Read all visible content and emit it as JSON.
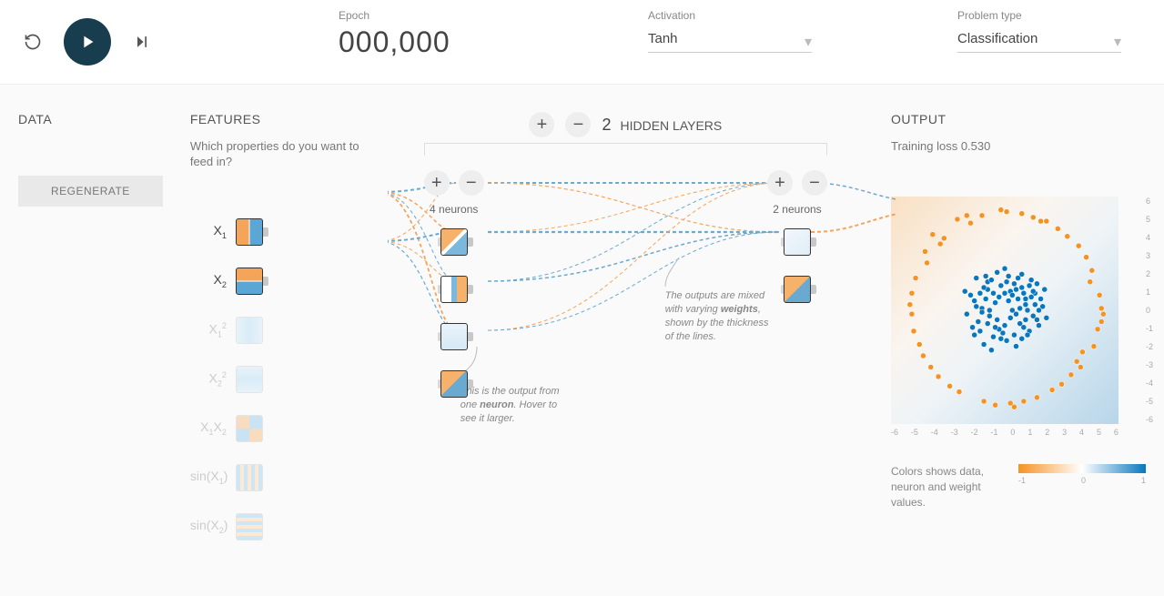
{
  "topbar": {
    "epoch_label": "Epoch",
    "epoch_value": "000,000",
    "activation_label": "Activation",
    "activation_value": "Tanh",
    "problem_label": "Problem type",
    "problem_value": "Classification"
  },
  "data": {
    "title": "DATA",
    "regenerate": "REGENERATE"
  },
  "features": {
    "title": "FEATURES",
    "subtitle": "Which properties do you want to feed in?",
    "items": [
      {
        "label": "X",
        "sub": "1",
        "active": true
      },
      {
        "label": "X",
        "sub": "2",
        "active": true
      },
      {
        "label": "X",
        "sub": "1",
        "sup": "2",
        "active": false
      },
      {
        "label": "X",
        "sub": "2",
        "sup": "2",
        "active": false
      },
      {
        "label": "X",
        "sub": "1",
        "label2": "X",
        "sub2": "2",
        "active": false
      },
      {
        "label": "sin(X",
        "sub": "1",
        "tail": ")",
        "active": false
      },
      {
        "label": "sin(X",
        "sub": "2",
        "tail": ")",
        "active": false
      }
    ]
  },
  "network": {
    "count": "2",
    "title": "HIDDEN LAYERS",
    "layers": [
      {
        "caption": "4 neurons",
        "neurons": 4
      },
      {
        "caption": "2 neurons",
        "neurons": 2
      }
    ],
    "callout_weights": "The outputs are mixed with varying weights, shown by the thickness of the lines.",
    "callout_weights_bold": "weights",
    "callout_neuron": "This is the output from one neuron. Hover to see it larger.",
    "callout_neuron_bold": "neuron"
  },
  "output": {
    "title": "OUTPUT",
    "loss_label": "Training loss",
    "loss_value": "0.530",
    "ticks": [
      "-6",
      "-5",
      "-4",
      "-3",
      "-2",
      "-1",
      "0",
      "1",
      "2",
      "3",
      "4",
      "5",
      "6"
    ],
    "legend_text": "Colors shows data, neuron and weight values.",
    "legend_ticks": [
      "-1",
      "0",
      "1"
    ]
  },
  "chart_data": {
    "type": "scatter",
    "title": "",
    "xlabel": "",
    "ylabel": "",
    "xlim": [
      -6,
      6
    ],
    "ylim": [
      -6,
      6
    ],
    "series": [
      {
        "name": "class-orange",
        "color": "#f59322",
        "points": [
          [
            -4.2,
            3.1
          ],
          [
            -3.8,
            4.0
          ],
          [
            -2.5,
            4.8
          ],
          [
            -1.2,
            5.0
          ],
          [
            0.1,
            5.2
          ],
          [
            1.5,
            4.9
          ],
          [
            2.8,
            4.3
          ],
          [
            3.9,
            3.4
          ],
          [
            4.6,
            2.1
          ],
          [
            5.0,
            0.8
          ],
          [
            5.1,
            -0.6
          ],
          [
            4.7,
            -1.9
          ],
          [
            4.0,
            -3.0
          ],
          [
            3.0,
            -3.9
          ],
          [
            1.7,
            -4.6
          ],
          [
            0.3,
            -4.9
          ],
          [
            -1.1,
            -4.8
          ],
          [
            -2.4,
            -4.3
          ],
          [
            -3.5,
            -3.5
          ],
          [
            -4.3,
            -2.4
          ],
          [
            -4.8,
            -1.1
          ],
          [
            -5.0,
            0.3
          ],
          [
            -4.7,
            1.7
          ],
          [
            -2.0,
            5.0
          ],
          [
            2.2,
            4.7
          ],
          [
            4.3,
            2.8
          ],
          [
            5.1,
            0.1
          ],
          [
            3.5,
            -3.4
          ],
          [
            -0.5,
            -5.0
          ],
          [
            -3.9,
            -3.0
          ],
          [
            -4.9,
            0.9
          ],
          [
            -3.2,
            3.8
          ],
          [
            0.9,
            5.1
          ],
          [
            3.3,
            3.9
          ],
          [
            4.9,
            -1.0
          ],
          [
            1.0,
            -4.8
          ],
          [
            -2.9,
            -4.0
          ],
          [
            -4.9,
            -0.2
          ],
          [
            4.5,
            1.5
          ],
          [
            -1.8,
            4.6
          ],
          [
            2.5,
            -4.2
          ],
          [
            -4.1,
            2.5
          ],
          [
            5.2,
            -0.2
          ],
          [
            -0.2,
            5.3
          ],
          [
            -4.5,
            -1.8
          ],
          [
            0.5,
            -5.1
          ],
          [
            3.8,
            -2.7
          ],
          [
            -3.4,
            3.5
          ],
          [
            1.9,
            4.7
          ],
          [
            4.1,
            -2.2
          ]
        ]
      },
      {
        "name": "class-blue",
        "color": "#0877bd",
        "points": [
          [
            0.2,
            0.5
          ],
          [
            -0.6,
            0.9
          ],
          [
            1.1,
            0.3
          ],
          [
            0.8,
            -0.7
          ],
          [
            -0.3,
            -1.0
          ],
          [
            -1.2,
            0.1
          ],
          [
            0.5,
            1.4
          ],
          [
            1.6,
            0.9
          ],
          [
            -0.9,
            1.5
          ],
          [
            1.3,
            -1.1
          ],
          [
            -1.4,
            -0.6
          ],
          [
            0.1,
            -1.6
          ],
          [
            2.0,
            0.2
          ],
          [
            -1.8,
            0.8
          ],
          [
            0.9,
            1.9
          ],
          [
            -0.4,
            2.0
          ],
          [
            1.8,
            -0.8
          ],
          [
            -1.6,
            -1.3
          ],
          [
            0.6,
            -1.9
          ],
          [
            2.1,
            1.1
          ],
          [
            -2.0,
            -0.2
          ],
          [
            1.4,
            1.6
          ],
          [
            -1.1,
            -1.8
          ],
          [
            0.0,
            2.2
          ],
          [
            2.2,
            -0.4
          ],
          [
            -0.7,
            -2.1
          ],
          [
            -2.1,
            1.0
          ],
          [
            1.7,
            1.4
          ],
          [
            -1.5,
            1.7
          ],
          [
            0.4,
            0.0
          ],
          [
            1.0,
            0.9
          ],
          [
            -0.2,
            1.3
          ],
          [
            0.7,
            0.6
          ],
          [
            -0.8,
            -0.3
          ],
          [
            1.2,
            0.0
          ],
          [
            -0.5,
            0.4
          ],
          [
            0.3,
            1.0
          ],
          [
            1.5,
            -0.3
          ],
          [
            -1.0,
            0.6
          ],
          [
            0.0,
            -0.8
          ],
          [
            0.9,
            1.2
          ],
          [
            -1.3,
            0.9
          ],
          [
            1.1,
            -0.5
          ],
          [
            -0.6,
            -1.4
          ],
          [
            1.9,
            0.6
          ],
          [
            -1.7,
            -0.9
          ],
          [
            0.2,
            1.8
          ],
          [
            1.3,
            1.3
          ],
          [
            -0.1,
            -1.2
          ],
          [
            0.6,
            -0.2
          ],
          [
            -0.9,
            1.1
          ],
          [
            1.6,
            0.3
          ],
          [
            -1.2,
            -0.1
          ],
          [
            0.8,
            0.1
          ],
          [
            -0.3,
            0.7
          ],
          [
            1.0,
            -0.9
          ],
          [
            -0.7,
            1.6
          ],
          [
            0.5,
            -1.3
          ],
          [
            1.4,
            0.7
          ],
          [
            -1.5,
            0.2
          ],
          [
            0.1,
            1.5
          ],
          [
            0.9,
            -1.5
          ],
          [
            -1.1,
            1.2
          ],
          [
            1.8,
            0.0
          ],
          [
            -0.4,
            -0.5
          ],
          [
            0.7,
            1.7
          ],
          [
            -1.6,
            0.5
          ],
          [
            1.2,
            -1.3
          ],
          [
            -0.8,
            0.0
          ],
          [
            0.3,
            -0.4
          ],
          [
            1.5,
            1.0
          ],
          [
            -1.3,
            -1.1
          ],
          [
            0.0,
            0.9
          ],
          [
            0.6,
            1.1
          ],
          [
            -0.2,
            -1.5
          ],
          [
            1.1,
            0.6
          ],
          [
            -0.9,
            -0.7
          ],
          [
            0.4,
            0.8
          ],
          [
            -0.5,
            -0.9
          ],
          [
            1.7,
            -0.5
          ],
          [
            -1.0,
            1.8
          ]
        ]
      }
    ]
  }
}
